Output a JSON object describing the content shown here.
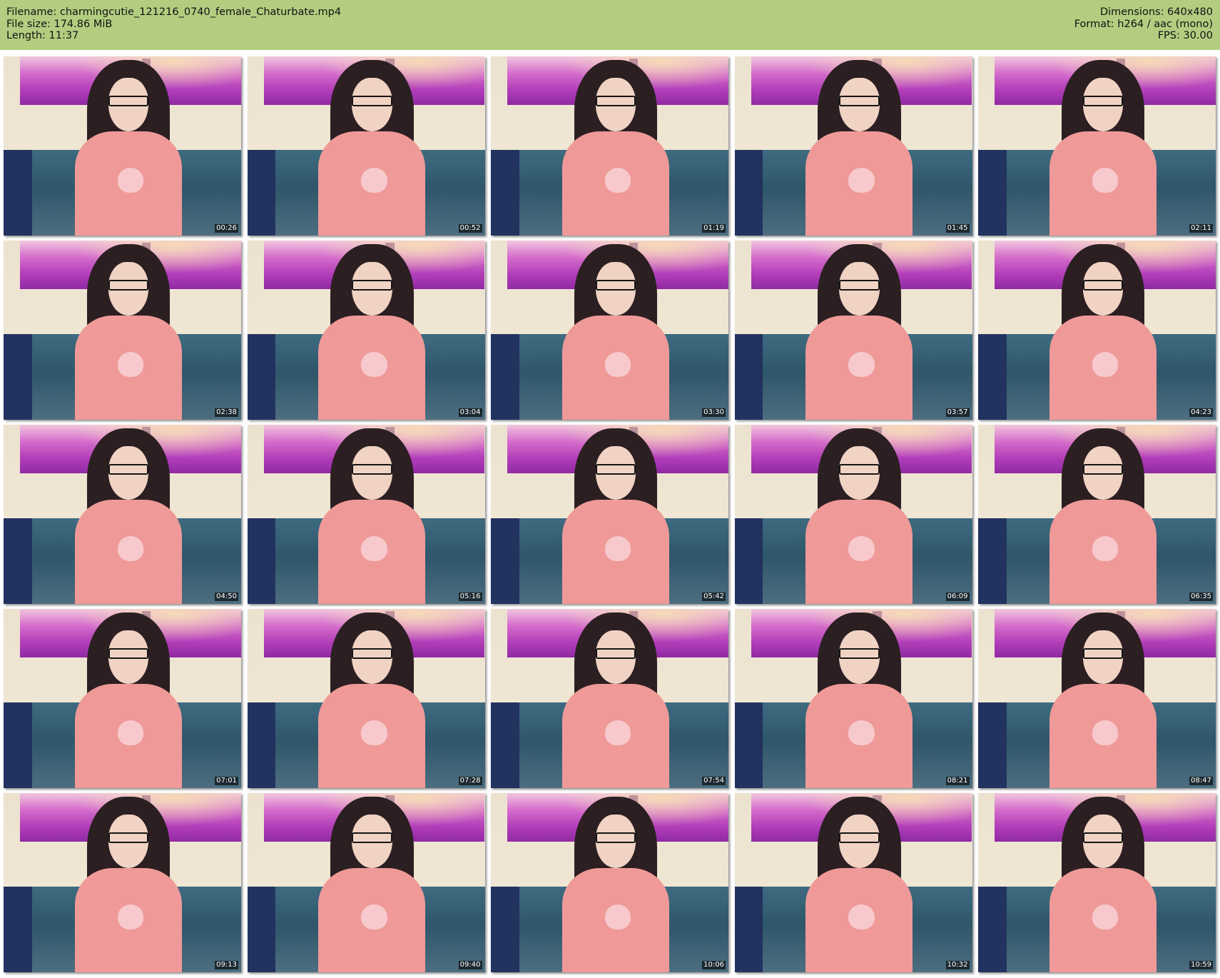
{
  "header": {
    "filename_label": "Filename: charmingcutie_121216_0740_female_Chaturbate.mp4",
    "filesize_label": "File size: 174.86 MiB",
    "length_label": "Length: 11:37",
    "dimensions_label": "Dimensions: 640x480",
    "format_label": "Format: h264 / aac (mono)",
    "fps_label": "FPS: 30.00",
    "background_color": "#b2cd80"
  },
  "thumbnails": [
    {
      "timestamp": "00:26"
    },
    {
      "timestamp": "00:52"
    },
    {
      "timestamp": "01:19"
    },
    {
      "timestamp": "01:45"
    },
    {
      "timestamp": "02:11"
    },
    {
      "timestamp": "02:38"
    },
    {
      "timestamp": "03:04"
    },
    {
      "timestamp": "03:30"
    },
    {
      "timestamp": "03:57"
    },
    {
      "timestamp": "04:23"
    },
    {
      "timestamp": "04:50"
    },
    {
      "timestamp": "05:16"
    },
    {
      "timestamp": "05:42"
    },
    {
      "timestamp": "06:09"
    },
    {
      "timestamp": "06:35"
    },
    {
      "timestamp": "07:01"
    },
    {
      "timestamp": "07:28"
    },
    {
      "timestamp": "07:54"
    },
    {
      "timestamp": "08:21"
    },
    {
      "timestamp": "08:47"
    },
    {
      "timestamp": "09:13"
    },
    {
      "timestamp": "09:40"
    },
    {
      "timestamp": "10:06"
    },
    {
      "timestamp": "10:32"
    },
    {
      "timestamp": "10:59"
    }
  ]
}
